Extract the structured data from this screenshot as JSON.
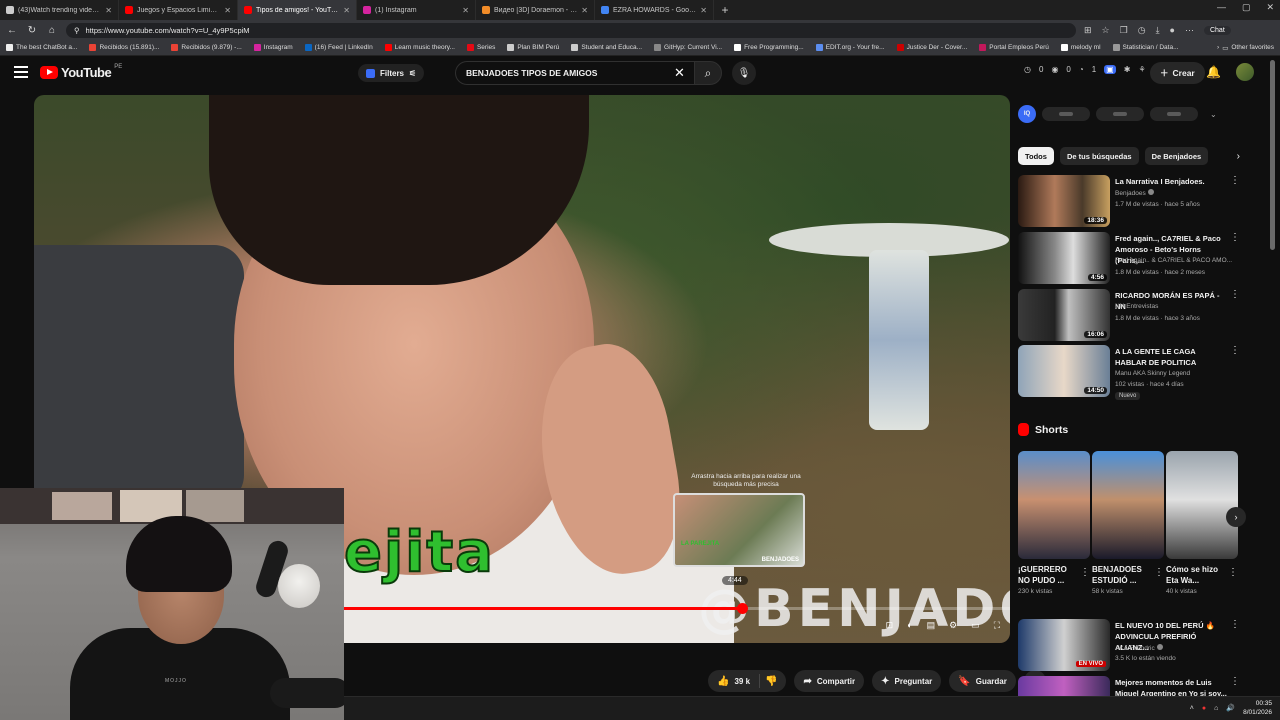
{
  "browser": {
    "tabs": [
      {
        "label": "(43)Watch trending videos for yo...",
        "color": "#cccccc",
        "active": false
      },
      {
        "label": "Juegos y Espacios Liminales - You",
        "color": "#ff0000",
        "active": false
      },
      {
        "label": "Tipos de amigos! - YouTube",
        "color": "#ff0000",
        "active": true
      },
      {
        "label": "(1) Instagram",
        "color": "#d6249f",
        "active": false
      },
      {
        "label": "Видео [3D] Doraemon - Stand By",
        "color": "#f28c28",
        "active": false
      },
      {
        "label": "EZRA HOWARDS - Google Search",
        "color": "#4285f4",
        "active": false
      }
    ],
    "url": "https://www.youtube.com/watch?v=U_4y9P5cpiM",
    "chat_label": "Chat",
    "other_favorites": "Other favorites",
    "bookmarks": [
      {
        "label": "The best ChatBot a...",
        "color": "#eeeeee"
      },
      {
        "label": "Recibidos (15.891)...",
        "color": "#ea4335"
      },
      {
        "label": "Recibidos (9.879) -...",
        "color": "#ea4335"
      },
      {
        "label": "Instagram",
        "color": "#d6249f"
      },
      {
        "label": "(16) Feed | LinkedIn",
        "color": "#0a66c2"
      },
      {
        "label": "Learn music theory...",
        "color": "#ff0000"
      },
      {
        "label": "Series",
        "color": "#e50914"
      },
      {
        "label": "Plan BIM Perú",
        "color": "#cccccc"
      },
      {
        "label": "Student and Educa...",
        "color": "#cccccc"
      },
      {
        "label": "GitHyp: Current Vi...",
        "color": "#888888"
      },
      {
        "label": "Free Programming...",
        "color": "#ffffff"
      },
      {
        "label": "EDIT.org - Your fre...",
        "color": "#5b8def"
      },
      {
        "label": "Justice Der - Cover...",
        "color": "#cc0000"
      },
      {
        "label": "Portal Empleos Perú",
        "color": "#c2185b"
      },
      {
        "label": "melody ml",
        "color": "#ffffff"
      },
      {
        "label": "Statistician / Data...",
        "color": "#999999"
      }
    ]
  },
  "yt": {
    "logo_text": "YouTube",
    "country": "PE",
    "filters_label": "Filters",
    "search_value": "BENJADOES TIPOS DE AMIGOS",
    "header_counts": [
      "0",
      "0",
      "1"
    ],
    "create_label": "Crear"
  },
  "player": {
    "caption_text": "ejita",
    "watermark_text": "@BENJADOES",
    "preview_hint": "Arrastra hacia arriba para realizar una búsqueda más precisa",
    "preview_label": "BENJADOES",
    "preview_sublabel": "LA PAREJITA",
    "preview_time": "4:44",
    "progress_fraction": 0.725
  },
  "webcam": {
    "hoodie_text": "MOJJO"
  },
  "actions": {
    "likes": "39 k",
    "share_label": "Compartir",
    "ask_label": "Preguntar",
    "save_label": "Guardar"
  },
  "taskbar": {
    "time": "00:35",
    "date": "8/01/2026"
  },
  "sidebar": {
    "chips": [
      "Todos",
      "De tus búsquedas",
      "De Benjadoes"
    ],
    "recommendations": [
      {
        "title": "La Narrativa I Benjadoes.",
        "channel": "Benjadoes",
        "meta": "1.7 M de vistas · hace 5 años",
        "duration": "18:36",
        "badge": ""
      },
      {
        "title": "Fred again.., CA7RIEL & Paco Amoroso - Beto's Horns (Paris,...",
        "channel": "Fred again.. & CA7RIEL & PACO AMO...",
        "meta": "1.8 M de vistas · hace 2 meses",
        "duration": "4:56",
        "badge": ""
      },
      {
        "title": "RICARDO MORÁN ES PAPÁ - NN",
        "channel": "NN Entrevistas",
        "meta": "1.8 M de vistas · hace 3 años",
        "duration": "16:06",
        "badge": ""
      },
      {
        "title": "A LA GENTE LE CAGA HABLAR DE POLITICA",
        "channel": "Manu AKA Skinny Legend",
        "meta": "102 vistas · hace 4 días",
        "duration": "14:50",
        "badge": "Nuevo"
      }
    ],
    "shorts_title": "Shorts",
    "shorts": [
      {
        "title": "¡GUERRERO NO PUDO ...",
        "views": "230 k vistas"
      },
      {
        "title": "BENJADOES ESTUDIÓ ...",
        "views": "58 k vistas"
      },
      {
        "title": "Cómo se hizo Eta Wa...",
        "views": "40 k vistas"
      }
    ],
    "more_recs": [
      {
        "title": "EL NUEVO 10 DEL PERÚ 🔥 ADVINCULA PREFIRIÓ ALIANZ...",
        "channel": "AKA Fanodric",
        "meta": "3.5 K lo están viendo",
        "live": "EN VIVO"
      },
      {
        "title": "Mejores momentos de Luis Miguel Argentino en Yo si soy...",
        "channel": "",
        "meta": "",
        "live": ""
      }
    ]
  }
}
